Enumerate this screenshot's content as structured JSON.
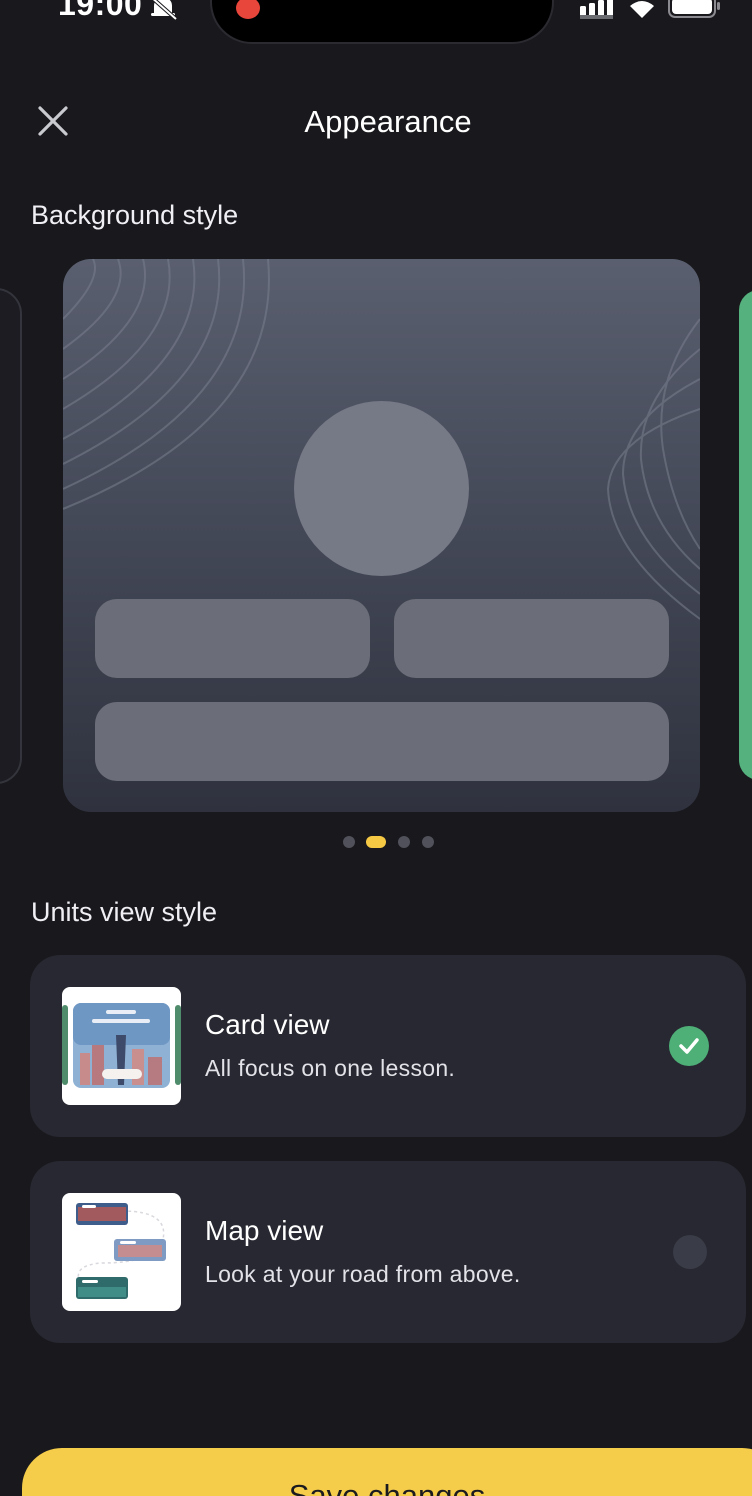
{
  "status_bar": {
    "time": "19:00",
    "icons": [
      "bell-off-icon",
      "recording-dot-icon",
      "signal-icon",
      "wifi-icon",
      "battery-icon"
    ]
  },
  "header": {
    "close_icon": "close-icon",
    "title": "Appearance"
  },
  "background_style": {
    "section_title": "Background style",
    "carousel_pages": 4,
    "active_page_index": 1
  },
  "units_view_style": {
    "section_title": "Units view style",
    "options": [
      {
        "title": "Card view",
        "subtitle": "All focus on one lesson.",
        "selected": true
      },
      {
        "title": "Map view",
        "subtitle": "Look at your road from above.",
        "selected": false
      }
    ]
  },
  "footer": {
    "save_label": "Save changes"
  },
  "colors": {
    "background": "#18181d",
    "card": "#272831",
    "accent_yellow": "#f6cd4a",
    "check_green": "#4eb077"
  }
}
